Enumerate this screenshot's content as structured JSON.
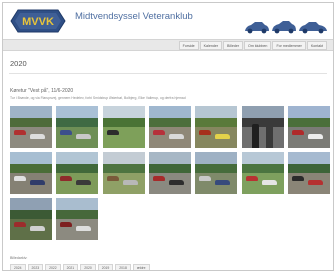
{
  "header": {
    "logo_text": "MVVK",
    "club_name": "Midtvendsyssel Veteranklub"
  },
  "nav": {
    "items": [
      "Forside",
      "Kalender",
      "Billeder",
      "Om klubben",
      "For medlemmer",
      "Kontakt"
    ]
  },
  "page": {
    "title": "2020"
  },
  "album": {
    "title": "Køretur \"Vest på\", 11/6-2020",
    "description": "Tur i Brønde, og via Flarupsvej, gennem Hedelev, forbi Smidstrup Østerbøl, Bolbjerg, Eike Vallerup, og derfra hjemad",
    "photos": [
      {
        "sky": "#9fb4c8",
        "trees": "#4e6b3a",
        "ground": "#8d8a7f",
        "cars": [
          "#b03030",
          "#dddddd"
        ]
      },
      {
        "sky": "#a9c0d6",
        "trees": "#3f6a43",
        "ground": "#6e8f56",
        "cars": [
          "#3c4f8c",
          "#c8c8c8"
        ]
      },
      {
        "sky": "#c7d3dc",
        "trees": "#4a7335",
        "ground": "#7ea05a",
        "cars": [
          "#2c2c2c"
        ]
      },
      {
        "sky": "#9fb7cf",
        "trees": "#4c6e3c",
        "ground": "#8f8878",
        "cars": [
          "#b6303a",
          "#d9d9d9"
        ]
      },
      {
        "sky": "#b6c6d2",
        "trees": "#5a7a3a",
        "ground": "#86875f",
        "cars": [
          "#a6301c",
          "#e3d24a"
        ]
      },
      {
        "sky": "#8f9fb0",
        "trees": "#3a3a3a",
        "ground": "#6f6f6f",
        "cars": [],
        "people": [
          "#1f1f1f",
          "#3a3a3a"
        ]
      },
      {
        "sky": "#9fb4d0",
        "trees": "#4b6f3a",
        "ground": "#7b7b76",
        "cars": [
          "#b02a2a",
          "#ececec"
        ]
      },
      {
        "sky": "#a7bed2",
        "trees": "#4a6d37",
        "ground": "#858174",
        "cars": [
          "#e0e0e0",
          "#303c6a"
        ]
      },
      {
        "sky": "#b1c5d4",
        "trees": "#41693a",
        "ground": "#7e9b5a",
        "cars": [
          "#8f2b2b",
          "#3a3a3a"
        ]
      },
      {
        "sky": "#c3ccd4",
        "trees": "#4e7440",
        "ground": "#8fa066",
        "cars": [
          "#7a5a3a",
          "#b8b8b8"
        ]
      },
      {
        "sky": "#a7b7c5",
        "trees": "#3f6638",
        "ground": "#8a8980",
        "cars": [
          "#a62a2a",
          "#2d2d2d"
        ]
      },
      {
        "sky": "#9eb1c4",
        "trees": "#466c3b",
        "ground": "#7f8a6a",
        "cars": [
          "#c9c9c9",
          "#364a7c"
        ]
      },
      {
        "sky": "#b7c8d6",
        "trees": "#4b7540",
        "ground": "#7ea05e",
        "cars": [
          "#b83232",
          "#e5e5e5"
        ]
      },
      {
        "sky": "#a6bad0",
        "trees": "#3d6438",
        "ground": "#8a8577",
        "cars": [
          "#2a2a2a",
          "#b53030"
        ]
      },
      {
        "sky": "#8fa0b3",
        "trees": "#3c5a35",
        "ground": "#5f7048",
        "cars": [
          "#9c2c2c",
          "#d0d0d0"
        ]
      },
      {
        "sky": "#a9bdcf",
        "trees": "#46683b",
        "ground": "#8c8a80",
        "cars": [
          "#7d1f1f",
          "#dedede"
        ]
      }
    ]
  },
  "archive": {
    "label": "Billedarkiv:",
    "years": [
      "2024",
      "2023",
      "2022",
      "2021",
      "2020",
      "2019",
      "2018",
      "ældre"
    ]
  },
  "colors": {
    "brand_blue": "#3f5f96",
    "title_blue": "#4f6fa1",
    "logo_yellow": "#e8c43a",
    "nav_bg": "#e8e8e8"
  }
}
